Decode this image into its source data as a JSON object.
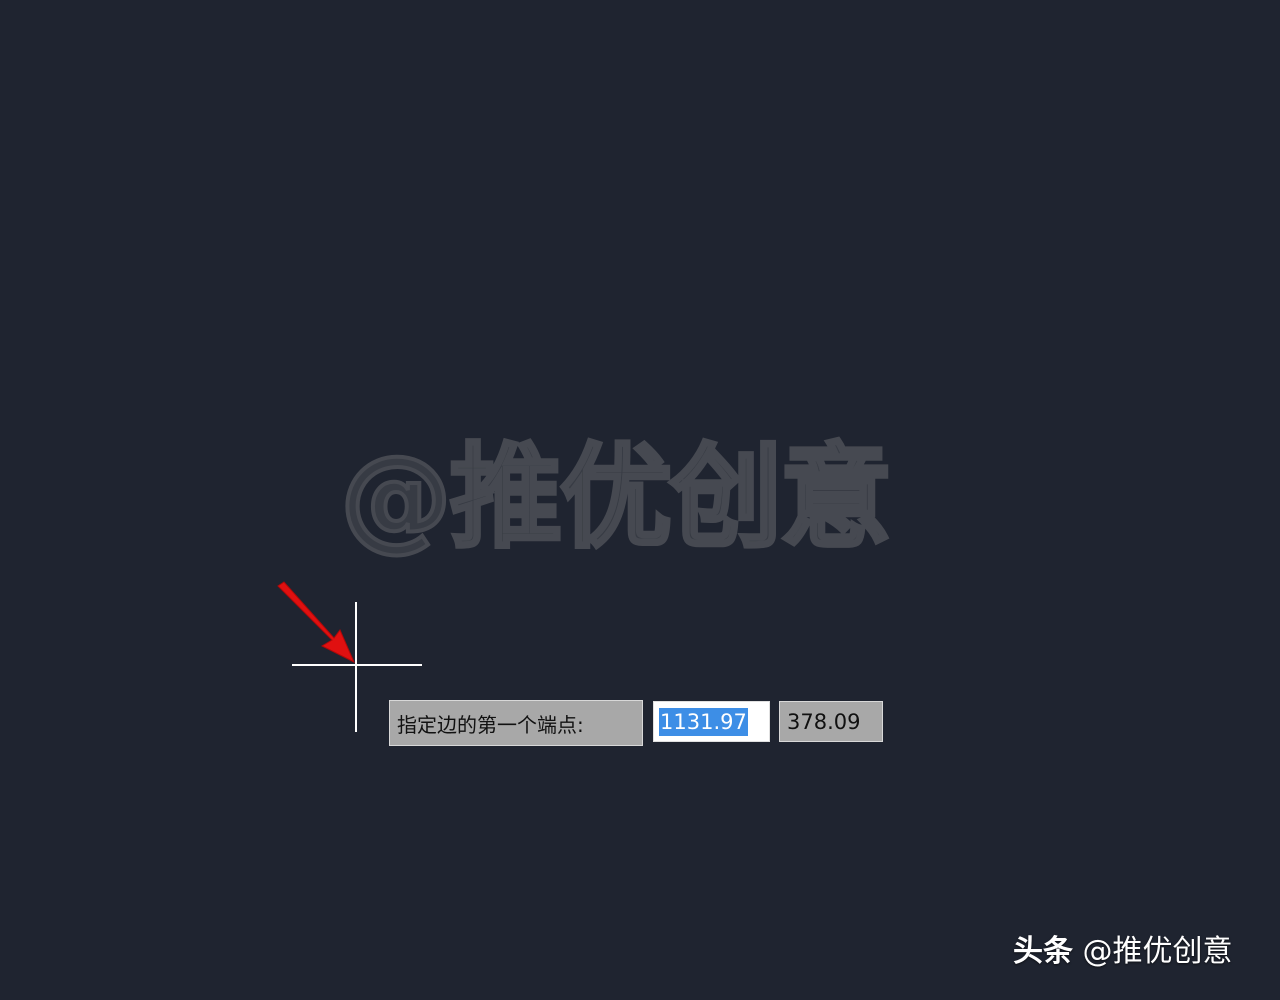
{
  "watermark": {
    "text": "@推优创意"
  },
  "dynamic_input": {
    "prompt": "指定边的第一个端点:",
    "x_value": "1131.97",
    "y_value": "378.09"
  },
  "credit": {
    "brand": "头条",
    "handle": "@推优创意"
  },
  "colors": {
    "background": "#1f2430",
    "crosshair": "#ffffff",
    "arrow": "#e01010",
    "selection": "#3d8ee6"
  },
  "icons": {
    "cursor": "crosshair-cursor-icon",
    "pointer": "red-arrow-icon"
  }
}
